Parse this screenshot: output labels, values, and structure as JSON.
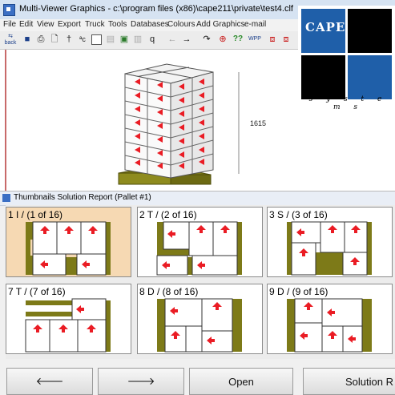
{
  "back_window": {
    "title": "Multi-Viewer Graphics - c:\\program files (x86)\\cape211\\private\\test4.clf",
    "menu": [
      "File",
      "Edit",
      "View",
      "Export",
      "Truck",
      "Tools",
      "Databases",
      "Colours",
      "Add Graphics",
      "e-mail"
    ],
    "toolbar_icons": [
      "back-icon",
      "save-icon",
      "print-icon",
      "print-preview-icon",
      "text-tool-icon",
      "text-abc-icon",
      "frame-icon",
      "disabled-icon",
      "image-icon",
      "disabled-icon-2",
      "zoom-icon",
      "arrow-left-icon",
      "arrow-right-icon",
      "rotate-icon",
      "crosshair-icon",
      "help-icon",
      "wpp-icon",
      "pdf-icon",
      "pdf-2-icon"
    ],
    "toolbar_texts": {
      "back": "back",
      "help": "??",
      "wpp": "WPP"
    },
    "dimension_label": "1615"
  },
  "logo": {
    "brand": "CAPE",
    "tagline": "s y s t e m s",
    "colors": {
      "black": "#000000",
      "blue": "#1f5fa9"
    }
  },
  "panel": {
    "title": "Thumbnails Solution Report (Pallet #1)"
  },
  "thumbnails": [
    {
      "label": "1 I / (1 of 16)",
      "selected": true
    },
    {
      "label": "2 T / (2 of 16)",
      "selected": false
    },
    {
      "label": "3 S / (3 of 16)",
      "selected": false
    },
    {
      "label": "7 T / (7 of 16)",
      "selected": false
    },
    {
      "label": "8 D / (8 of 16)",
      "selected": false
    },
    {
      "label": "9 D / (9 of 16)",
      "selected": false
    }
  ],
  "buttons": {
    "prev_icon": "🡐",
    "next_icon": "🡒",
    "open": "Open",
    "solution": "Solution R"
  },
  "colors": {
    "pallet_olive": "#7d7a18",
    "arrow_red": "#ea1c24",
    "selected_tile": "#f6d9b3"
  }
}
